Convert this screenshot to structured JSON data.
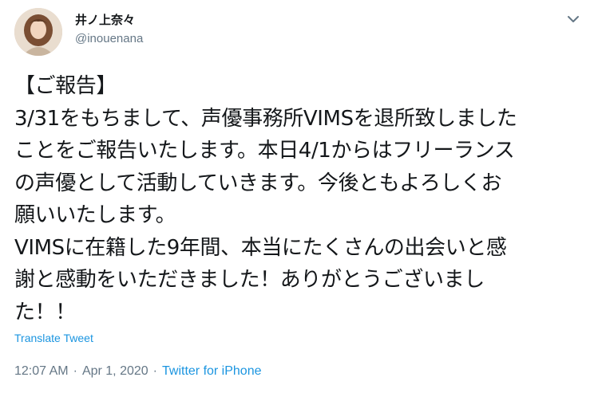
{
  "author": {
    "display_name": "井ノ上奈々",
    "handle": "@inouenana"
  },
  "tweet": {
    "lines": [
      "【ご報告】",
      "3/31をもちまして、声優事務所VIMSを退所致しました",
      "ことをご報告いたします。本日4/1からはフリーランス",
      "の声優として活動していきます。今後ともよろしくお",
      "願いいたします。",
      "VIMSに在籍した9年間、本当にたくさんの出会いと感",
      "謝と感動をいただきました！ありがとうございまし",
      "た！！"
    ],
    "translate_label": "Translate Tweet",
    "time": "12:07 AM",
    "separator": "·",
    "date": "Apr 1, 2020",
    "source": "Twitter for iPhone"
  },
  "icons": {
    "caret": "chevron-down-icon",
    "avatar": "avatar"
  },
  "colors": {
    "link": "#1b95e0",
    "secondary_text": "#657786",
    "primary_text": "#14171a"
  }
}
